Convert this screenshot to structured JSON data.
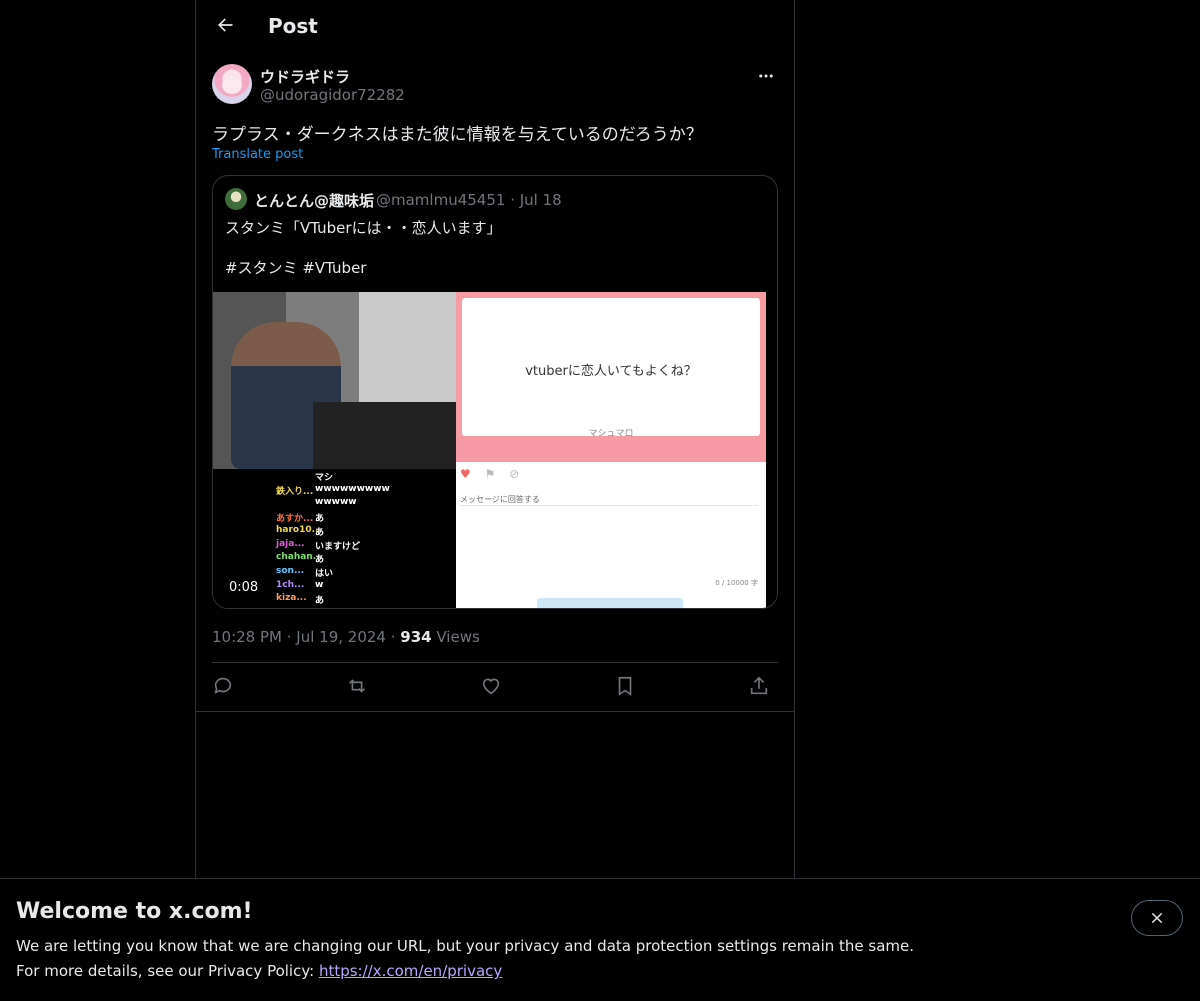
{
  "header": {
    "title": "Post",
    "back_icon": "arrow-left-icon"
  },
  "post": {
    "author_name": "ウドラギドラ",
    "author_handle": "@udoragidor72282",
    "text": "ラプラス・ダークネスはまた彼に情報を与えているのだろうか？",
    "translate_label": "Translate post",
    "time": "10:28 PM",
    "date": "Jul 19, 2024",
    "views_count": "934",
    "views_label": "Views"
  },
  "quote": {
    "author_name": "とんとん@趣味垢",
    "author_handle": "@mamlmu45451",
    "date": "Jul 18",
    "text_line1": "スタンミ「VTuberには・・恋人います」",
    "text_line2": "#スタンミ #VTuber",
    "video_timestamp": "0:08",
    "chat": [
      {
        "name": "",
        "msg": "マシ",
        "color": "#ffffff"
      },
      {
        "name": "鉄入り...",
        "msg": "wwwwwwwww",
        "color": "#f2d94c"
      },
      {
        "name": "",
        "msg": "wwwww",
        "color": "#ffffff"
      },
      {
        "name": "あすか...",
        "msg": "あ",
        "color": "#ff7043"
      },
      {
        "name": "haro10...",
        "msg": "あ",
        "color": "#f2d94c"
      },
      {
        "name": "jaja...",
        "msg": "いますけど",
        "color": "#e05bd8"
      },
      {
        "name": "chahan...",
        "msg": "あ",
        "color": "#7ce06c"
      },
      {
        "name": "son...",
        "msg": "はい",
        "color": "#62c6ff"
      },
      {
        "name": "1ch...",
        "msg": "w",
        "color": "#b58cff"
      },
      {
        "name": "kiza...",
        "msg": "あ",
        "color": "#ff9a5c"
      }
    ],
    "marshmallow_question": "vtuberに恋人いてもよくね？",
    "marshmallow_brand": "マシュマロ",
    "marshmallow_reply": "メッセージに回答する",
    "marshmallow_count": "0 / 10000 字"
  },
  "actions": [
    {
      "icon": "reply-icon"
    },
    {
      "icon": "repost-icon"
    },
    {
      "icon": "like-icon"
    },
    {
      "icon": "bookmark-icon"
    },
    {
      "icon": "share-icon"
    }
  ],
  "banner": {
    "title": "Welcome to x.com!",
    "line1": "We are letting you know that we are changing our URL, but your privacy and data protection settings remain the same.",
    "line2_prefix": "For more details, see our Privacy Policy: ",
    "link": "https://x.com/en/privacy"
  },
  "colors": {
    "accent": "#1d9bf0",
    "muted": "#71767b",
    "text": "#e7e9ea",
    "border": "#2f3336"
  }
}
